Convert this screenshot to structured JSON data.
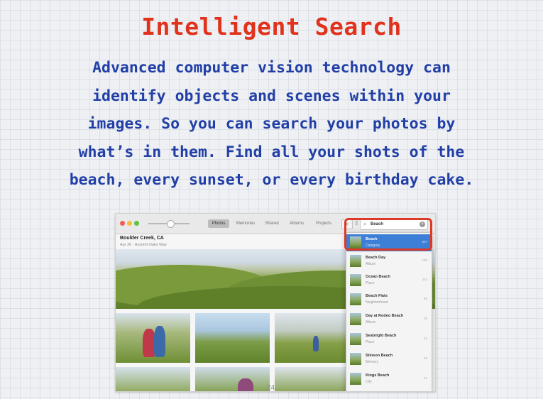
{
  "slide": {
    "title": "Intelligent Search",
    "body_lines": [
      "Advanced computer vision technology can",
      "identify objects and scenes within your",
      "images. So you can search your photos by",
      "what’s in them. Find all your shots of the",
      "beach, every sunset, or every birthday cake."
    ],
    "page_number": "24"
  },
  "photos_app": {
    "tabs": [
      "Photos",
      "Memories",
      "Shared",
      "Albums",
      "Projects"
    ],
    "active_tab": "Photos",
    "search": {
      "query": "Beach"
    },
    "location": {
      "title": "Boulder Creek, CA",
      "subtitle": "Apr 26 · Ancient Oaks Way"
    },
    "results": [
      {
        "name": "Beach",
        "type": "Category",
        "count": "307"
      },
      {
        "name": "Beach Day",
        "type": "Album",
        "count": "189"
      },
      {
        "name": "Ocean Beach",
        "type": "Place",
        "count": "112"
      },
      {
        "name": "Beach Flats",
        "type": "Neighborhood",
        "count": "46"
      },
      {
        "name": "Day at Rodeo Beach",
        "type": "Album",
        "count": "28"
      },
      {
        "name": "Seabright Beach",
        "type": "Place",
        "count": "24"
      },
      {
        "name": "Stinson Beach",
        "type": "Memory",
        "count": "18"
      },
      {
        "name": "Kings Beach",
        "type": "City",
        "count": "12"
      }
    ]
  },
  "colors": {
    "title": "#e0321c",
    "body": "#213fa6",
    "highlight": "#dc3a26",
    "selection": "#3d7fd6"
  }
}
